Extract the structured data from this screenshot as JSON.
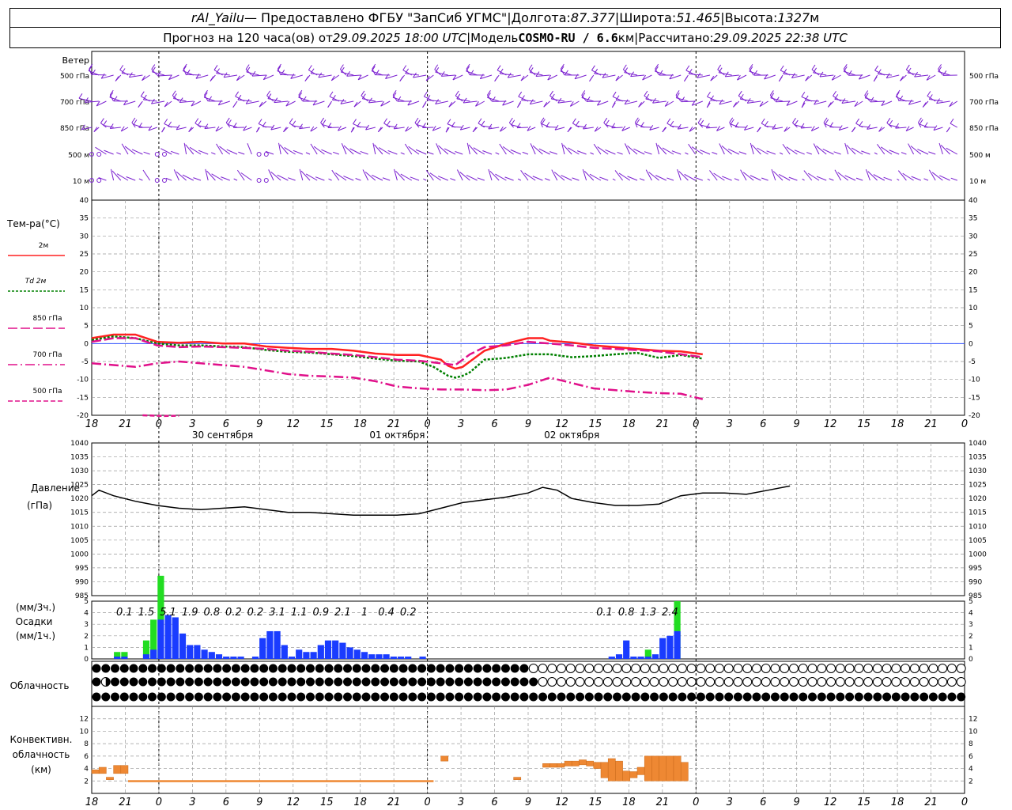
{
  "header": {
    "station": "rAl_Yailu",
    "provider": "— Предоставлено ФГБУ \"ЗапСиб УГМС\"",
    "lon_label": "Долгота:",
    "lon": "87.377",
    "lat_label": "Широта:",
    "lat": "51.465",
    "alt_label": "Высота:",
    "alt": "1327",
    "alt_unit": "м",
    "forecast_prefix": "Прогноз на 120 часа(ов) от",
    "forecast_start": "29.09.2025 18:00 UTC",
    "model_label": "Модель",
    "model": "COSMO-RU / 6.6",
    "model_unit": "км",
    "computed_label": "Рассчитано:",
    "computed": "29.09.2025 22:38 UTC",
    "sep": "|"
  },
  "colors": {
    "wind": "#7a1fd0",
    "t2m": "#ff2020",
    "td2m": "#008000",
    "t850": "#e0108a",
    "t700": "#e0108a",
    "t500": "#e0108a",
    "pressure": "#000000",
    "precip_hourly": "#1a3cff",
    "precip_3h": "#22dd22",
    "convective": "#ee8833",
    "zero_line": "#3050ff",
    "grid": "#999999"
  },
  "panels": {
    "wind_title": "Ветер",
    "wind_levels": [
      "500 гПа",
      "700 гПа",
      "850 гПа",
      "500 м",
      "10 м"
    ],
    "temp_title": "Тем-ра(°C)",
    "temp_legend": [
      "2м",
      "Td 2м",
      "850 гПа",
      "700 гПа",
      "500 гПа"
    ],
    "pressure_title": "Давление",
    "pressure_unit": "(гПа)",
    "precip_unit3": "(мм/3ч.)",
    "precip_title": "Осадки",
    "precip_unit1": "(мм/1ч.)",
    "cloud_title": "Облачность",
    "conv_title_1": "Конвективн.",
    "conv_title_2": "облачность",
    "conv_unit": "(км)"
  },
  "chart_data": {
    "type": "meteogram",
    "x_hours_from_start": [
      0,
      120
    ],
    "x_tick_labels": [
      "18",
      "21",
      "0",
      "3",
      "6",
      "9",
      "12",
      "15",
      "18",
      "21",
      "0",
      "3",
      "6",
      "9",
      "12",
      "15",
      "18",
      "21",
      "0",
      "3",
      "6",
      "9",
      "12",
      "15",
      "18",
      "21",
      "0"
    ],
    "day_labels": [
      {
        "label": "30 сентября",
        "hour": 18
      },
      {
        "label": "01 октября",
        "hour": 42
      },
      {
        "label": "02 октября",
        "hour": 66
      }
    ],
    "temperature": {
      "ylim": [
        -20,
        40
      ],
      "yticks": [
        40,
        35,
        30,
        25,
        20,
        15,
        10,
        5,
        0,
        -5,
        -10,
        -15,
        -20
      ],
      "series": [
        {
          "key": "t2m",
          "name": "2м",
          "points": [
            [
              0,
              1.5
            ],
            [
              3,
              2.5
            ],
            [
              6,
              2.5
            ],
            [
              9,
              0.5
            ],
            [
              12,
              0.2
            ],
            [
              15,
              0.5
            ],
            [
              18,
              0
            ],
            [
              21,
              0
            ],
            [
              24,
              -0.8
            ],
            [
              27,
              -1.2
            ],
            [
              30,
              -1.5
            ],
            [
              33,
              -1.5
            ],
            [
              36,
              -2
            ],
            [
              39,
              -2.8
            ],
            [
              42,
              -3.2
            ],
            [
              45,
              -3.2
            ],
            [
              48,
              -4.5
            ],
            [
              49,
              -6.2
            ],
            [
              50,
              -7
            ],
            [
              51,
              -6.5
            ],
            [
              52,
              -5
            ],
            [
              54,
              -2
            ],
            [
              57,
              0
            ],
            [
              60,
              1.5
            ],
            [
              62,
              1.5
            ],
            [
              63,
              0.8
            ],
            [
              66,
              0.3
            ],
            [
              69,
              -0.5
            ],
            [
              72,
              -1
            ],
            [
              75,
              -1.5
            ],
            [
              78,
              -2
            ],
            [
              81,
              -2.2
            ],
            [
              84,
              -3
            ]
          ]
        },
        {
          "key": "td2m",
          "name": "Td 2м",
          "points": [
            [
              0,
              1
            ],
            [
              3,
              2
            ],
            [
              6,
              1.5
            ],
            [
              9,
              0
            ],
            [
              12,
              -0.5
            ],
            [
              15,
              -0.5
            ],
            [
              18,
              -0.8
            ],
            [
              21,
              -1
            ],
            [
              24,
              -1.8
            ],
            [
              27,
              -2.3
            ],
            [
              30,
              -2.5
            ],
            [
              33,
              -3
            ],
            [
              36,
              -3.5
            ],
            [
              39,
              -4.2
            ],
            [
              42,
              -4.8
            ],
            [
              45,
              -5
            ],
            [
              47,
              -6.5
            ],
            [
              49,
              -9
            ],
            [
              50,
              -9.5
            ],
            [
              51,
              -9
            ],
            [
              52,
              -8
            ],
            [
              54,
              -4.5
            ],
            [
              57,
              -4
            ],
            [
              60,
              -3
            ],
            [
              63,
              -3
            ],
            [
              66,
              -3.8
            ],
            [
              69,
              -3.5
            ],
            [
              72,
              -3
            ],
            [
              75,
              -2.6
            ],
            [
              78,
              -4
            ],
            [
              81,
              -3.2
            ],
            [
              84,
              -4.2
            ]
          ]
        },
        {
          "key": "t850",
          "name": "850 гПа",
          "points": [
            [
              0,
              0.5
            ],
            [
              3,
              1.5
            ],
            [
              6,
              1.5
            ],
            [
              9,
              -0.5
            ],
            [
              12,
              -1
            ],
            [
              15,
              -0.8
            ],
            [
              18,
              -1
            ],
            [
              21,
              -1.2
            ],
            [
              24,
              -1.5
            ],
            [
              27,
              -2
            ],
            [
              30,
              -2.3
            ],
            [
              33,
              -2.8
            ],
            [
              36,
              -3.2
            ],
            [
              39,
              -3.8
            ],
            [
              42,
              -4.5
            ],
            [
              45,
              -4.8
            ],
            [
              48,
              -5.5
            ],
            [
              50,
              -6
            ],
            [
              52,
              -3
            ],
            [
              54,
              -1
            ],
            [
              57,
              -0.5
            ],
            [
              60,
              0.5
            ],
            [
              63,
              0
            ],
            [
              66,
              -0.5
            ],
            [
              69,
              -1.2
            ],
            [
              72,
              -1.5
            ],
            [
              75,
              -1.8
            ],
            [
              78,
              -2.2
            ],
            [
              81,
              -3
            ],
            [
              84,
              -3.8
            ]
          ]
        },
        {
          "key": "t700",
          "name": "700 гПа",
          "points": [
            [
              0,
              -5.5
            ],
            [
              3,
              -6
            ],
            [
              6,
              -6.5
            ],
            [
              9,
              -5.5
            ],
            [
              12,
              -5
            ],
            [
              15,
              -5.5
            ],
            [
              18,
              -6
            ],
            [
              21,
              -6.5
            ],
            [
              24,
              -7.5
            ],
            [
              27,
              -8.5
            ],
            [
              30,
              -9
            ],
            [
              33,
              -9.2
            ],
            [
              36,
              -9.5
            ],
            [
              39,
              -10.5
            ],
            [
              42,
              -12
            ],
            [
              45,
              -12.5
            ],
            [
              48,
              -12.8
            ],
            [
              51,
              -12.8
            ],
            [
              54,
              -13
            ],
            [
              57,
              -12.8
            ],
            [
              60,
              -11.5
            ],
            [
              63,
              -9.5
            ],
            [
              66,
              -11
            ],
            [
              69,
              -12.5
            ],
            [
              72,
              -13
            ],
            [
              75,
              -13.5
            ],
            [
              78,
              -13.8
            ],
            [
              81,
              -14
            ],
            [
              84,
              -15.5
            ]
          ]
        },
        {
          "key": "t500",
          "name": "500 гПа",
          "points": [
            [
              7,
              -20
            ],
            [
              10,
              -20.2
            ],
            [
              12,
              -20.1
            ]
          ]
        }
      ]
    },
    "pressure": {
      "ylim": [
        985,
        1040
      ],
      "yticks": [
        1040,
        1035,
        1030,
        1025,
        1020,
        1015,
        1010,
        1005,
        1000,
        995,
        990,
        985
      ],
      "points": [
        [
          0,
          1021
        ],
        [
          1,
          1023
        ],
        [
          3,
          1021
        ],
        [
          6,
          1019
        ],
        [
          9,
          1017.5
        ],
        [
          12,
          1016.5
        ],
        [
          15,
          1016
        ],
        [
          18,
          1016.5
        ],
        [
          21,
          1017
        ],
        [
          24,
          1016
        ],
        [
          27,
          1015
        ],
        [
          30,
          1015
        ],
        [
          33,
          1014.5
        ],
        [
          36,
          1014
        ],
        [
          39,
          1014
        ],
        [
          42,
          1014
        ],
        [
          45,
          1014.5
        ],
        [
          48,
          1016.5
        ],
        [
          51,
          1018.5
        ],
        [
          54,
          1019.5
        ],
        [
          57,
          1020.5
        ],
        [
          60,
          1022
        ],
        [
          62,
          1024
        ],
        [
          64,
          1023
        ],
        [
          66,
          1020
        ],
        [
          69,
          1018.5
        ],
        [
          72,
          1017.5
        ],
        [
          75,
          1017.5
        ],
        [
          78,
          1018
        ],
        [
          81,
          1021
        ],
        [
          84,
          1022
        ],
        [
          87,
          1022
        ],
        [
          90,
          1021.5
        ],
        [
          93,
          1023
        ],
        [
          96,
          1024.5
        ]
      ]
    },
    "precipitation": {
      "hourly_ylim": [
        0,
        5
      ],
      "yticks": [
        5,
        4,
        3,
        2,
        1,
        0
      ],
      "three_hour_labels": [
        {
          "hour": 4.5,
          "value": "0.1"
        },
        {
          "hour": 7.5,
          "value": "1.5"
        },
        {
          "hour": 10.5,
          "value": "5.1"
        },
        {
          "hour": 13.5,
          "value": "1.9"
        },
        {
          "hour": 16.5,
          "value": "0.8"
        },
        {
          "hour": 19.5,
          "value": "0.2"
        },
        {
          "hour": 22.5,
          "value": "0.2"
        },
        {
          "hour": 25.5,
          "value": "3.1"
        },
        {
          "hour": 28.5,
          "value": "1.1"
        },
        {
          "hour": 31.5,
          "value": "0.9"
        },
        {
          "hour": 34.5,
          "value": "2.1"
        },
        {
          "hour": 37.5,
          "value": "1"
        },
        {
          "hour": 40.5,
          "value": "0.4"
        },
        {
          "hour": 43.5,
          "value": "0.2"
        },
        {
          "hour": 70.5,
          "value": "0.1"
        },
        {
          "hour": 73.5,
          "value": "0.8"
        },
        {
          "hour": 76.5,
          "value": "1.3"
        },
        {
          "hour": 79.5,
          "value": "2.4"
        }
      ],
      "hourly": [
        0,
        0,
        0,
        0.1,
        0.1,
        0,
        0,
        0.2,
        0.4,
        1.7,
        1.9,
        1.8,
        1.1,
        0.6,
        0.6,
        0.4,
        0.3,
        0.2,
        0.1,
        0.1,
        0.1,
        0,
        0.1,
        0.9,
        1.2,
        1.2,
        0.6,
        0.1,
        0.4,
        0.3,
        0.3,
        0.6,
        0.8,
        0.8,
        0.7,
        0.5,
        0.4,
        0.3,
        0.2,
        0.2,
        0.2,
        0.1,
        0.1,
        0.1,
        0,
        0.1,
        0,
        0,
        0,
        0,
        0,
        0,
        0,
        0,
        0,
        0,
        0,
        0,
        0,
        0,
        0,
        0,
        0,
        0,
        0,
        0,
        0,
        0,
        0,
        0,
        0,
        0.1,
        0.2,
        0.8,
        0.1,
        0.1,
        0.1,
        0.2,
        0.9,
        1.0,
        1.2,
        0
      ],
      "three_hourly_extra": [
        0,
        0,
        0,
        0.2,
        0.2,
        0,
        0,
        0.6,
        1.3,
        1.9,
        0,
        0,
        0,
        0,
        0,
        0,
        0,
        0,
        0,
        0,
        0,
        0,
        0,
        0,
        0,
        0,
        0,
        0,
        0,
        0,
        0,
        0,
        0,
        0,
        0,
        0,
        0,
        0,
        0,
        0,
        0,
        0,
        0,
        0,
        0,
        0,
        0,
        0,
        0,
        0,
        0,
        0,
        0,
        0,
        0,
        0,
        0,
        0,
        0,
        0,
        0,
        0,
        0,
        0,
        0,
        0,
        0,
        0,
        0,
        0,
        0,
        0,
        0,
        0,
        0,
        0,
        0.3,
        0,
        0,
        0,
        1.3,
        0
      ]
    },
    "cloudiness": {
      "note": "okta symbols per level (low/mid/high rows)",
      "rows": [
        "88888888888888888888888888888888888888888888888000000000000000000000000000000000000000000000000",
        "84888888888888888888888888888888888888888888888800000000000000000000000000000000000000000000000",
        "88888888888888888888888888888888888888888888888888888888888888888888888888888888888888888888888"
      ]
    },
    "convective": {
      "ylim": [
        0,
        14
      ],
      "yticks": [
        12,
        10,
        8,
        6,
        4,
        2
      ],
      "bars": [
        {
          "hour": 0,
          "base": 3.2,
          "top": 3.8
        },
        {
          "hour": 1,
          "base": 3.2,
          "top": 4.2
        },
        {
          "hour": 2,
          "base": 2.2,
          "top": 2.6
        },
        {
          "hour": 3,
          "base": 3.2,
          "top": 4.5
        },
        {
          "hour": 4,
          "base": 3.2,
          "top": 4.5
        },
        {
          "hour": 48,
          "base": 5.2,
          "top": 6
        },
        {
          "hour": 58,
          "base": 2.2,
          "top": 2.6
        },
        {
          "hour": 62,
          "base": 4.2,
          "top": 4.8
        },
        {
          "hour": 63,
          "base": 4.2,
          "top": 4.8
        },
        {
          "hour": 64,
          "base": 4.2,
          "top": 4.8
        },
        {
          "hour": 65,
          "base": 4.4,
          "top": 5.2
        },
        {
          "hour": 66,
          "base": 4.4,
          "top": 5.2
        },
        {
          "hour": 67,
          "base": 4.6,
          "top": 5.4
        },
        {
          "hour": 68,
          "base": 4.4,
          "top": 5.2
        },
        {
          "hour": 69,
          "base": 4,
          "top": 5
        },
        {
          "hour": 70,
          "base": 2.5,
          "top": 5
        },
        {
          "hour": 71,
          "base": 2,
          "top": 5.6
        },
        {
          "hour": 72,
          "base": 2,
          "top": 5.2
        },
        {
          "hour": 73,
          "base": 2,
          "top": 3.6
        },
        {
          "hour": 74,
          "base": 2.5,
          "top": 3.5
        },
        {
          "hour": 75,
          "base": 3,
          "top": 4.2
        },
        {
          "hour": 76,
          "base": 2,
          "top": 6
        },
        {
          "hour": 77,
          "base": 2,
          "top": 6
        },
        {
          "hour": 78,
          "base": 2,
          "top": 6
        },
        {
          "hour": 79,
          "base": 2,
          "top": 6
        },
        {
          "hour": 80,
          "base": 2,
          "top": 6
        },
        {
          "hour": 81,
          "base": 2,
          "top": 5
        }
      ],
      "flat_line": {
        "from_hour": 5,
        "to_hour": 47,
        "value": 2
      }
    }
  }
}
